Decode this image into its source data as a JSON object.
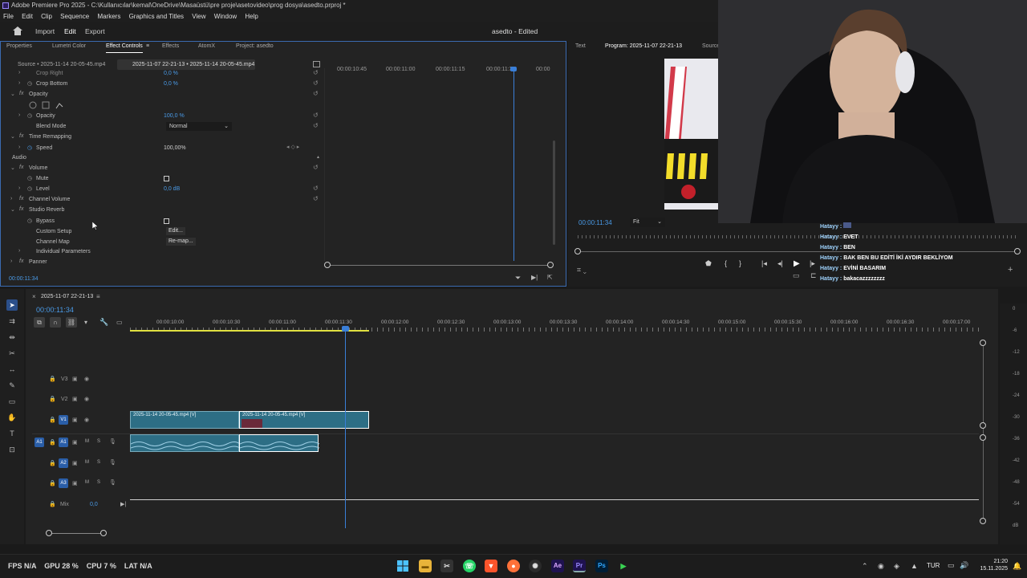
{
  "window": {
    "title": "Adobe Premiere Pro 2025 - C:\\Kullanıcılar\\kemal\\OneDrive\\Masaüstü\\pre proje\\asetovideo\\prog dosya\\asedto.prproj *"
  },
  "menu": [
    "File",
    "Edit",
    "Clip",
    "Sequence",
    "Markers",
    "Graphics and Titles",
    "View",
    "Window",
    "Help"
  ],
  "workspace": {
    "import": "Import",
    "edit": "Edit",
    "export": "Export",
    "project": "asedto - Edited"
  },
  "left_tabs": [
    "Properties",
    "Lumetri Color",
    "Effect Controls",
    "Effects",
    "AtomX",
    "Project: asedto"
  ],
  "ec": {
    "source": "Source • 2025-11-14 20-05-45.mp4",
    "sequence": "2025-11-07 22-21-13 • 2025-11-14 20-05-45.mp4",
    "ruler": [
      "00:00:10:45",
      "00:00:11:00",
      "00:00:11:15",
      "00:00:11:30",
      "00:00"
    ],
    "rows": {
      "crop_right": "Crop Right",
      "crop_right_val": "0,0 %",
      "crop_bottom": "Crop Bottom",
      "crop_bottom_val": "0,0 %",
      "opacity_hdr": "Opacity",
      "opacity": "Opacity",
      "opacity_val": "100,0 %",
      "blend": "Blend Mode",
      "blend_val": "Normal",
      "time_remap": "Time Remapping",
      "speed": "Speed",
      "speed_val": "100,00%",
      "audio": "Audio",
      "volume": "Volume",
      "mute": "Mute",
      "level": "Level",
      "level_val": "0,0 dB",
      "chan_vol": "Channel Volume",
      "reverb": "Studio Reverb",
      "bypass": "Bypass",
      "custom": "Custom Setup",
      "custom_btn": "Edit...",
      "chan_map": "Channel Map",
      "chan_map_btn": "Re-map...",
      "indiv": "Individual Parameters",
      "panner": "Panner"
    },
    "timecode": "00:00:11:34"
  },
  "program": {
    "tabs": [
      "Text",
      "Program: 2025-11-07 22-21-13",
      "Source"
    ],
    "timecode": "00:00:11:34",
    "fit": "Fit"
  },
  "timeline": {
    "seq_name": "2025-11-07 22-21-13",
    "timecode": "00:00:11:34",
    "ruler": [
      "00:00:10:00",
      "00:00:10:30",
      "00:00:11:00",
      "00:00:11:30",
      "00:00:12:00",
      "00:00:12:30",
      "00:00:13:00",
      "00:00:13:30",
      "00:00:14:00",
      "00:00:14:30",
      "00:00:15:00",
      "00:00:15:30",
      "00:00:16:00",
      "00:00:16:30",
      "00:00:17:00"
    ],
    "tracks": {
      "v3": "V3",
      "v2": "V2",
      "v1": "V1",
      "a1": "A1",
      "a2": "A2",
      "a3": "A3",
      "mix": "Mix",
      "mix_val": "0,0"
    },
    "clip1": "2025-11-14 20-05-45.mp4 [V]",
    "clip2": "2025-11-14 20-05-45.mp4 [V]",
    "meter_scale": [
      "0",
      "-6",
      "-12",
      "-18",
      "-24",
      "-30",
      "-36",
      "-42",
      "-48",
      "-54",
      "dB"
    ]
  },
  "chat": [
    {
      "name": "Hatayy :",
      "msg": ""
    },
    {
      "name": "Hatayy :",
      "msg": "EVET"
    },
    {
      "name": "Hatayy :",
      "msg": "BEN"
    },
    {
      "name": "Hatayy :",
      "msg": "BAK BEN BU EDİTİ İKİ AYDIR BEKLİYOM"
    },
    {
      "name": "Hatayy :",
      "msg": "EVİNİ BASARIM"
    },
    {
      "name": "Hatayy :",
      "msg": "bakacazzzzzzzz"
    }
  ],
  "stats": {
    "fps_l": "FPS",
    "fps": "N/A",
    "gpu_l": "GPU",
    "gpu": "28 %",
    "cpu_l": "CPU",
    "cpu": "7 %",
    "lat_l": "LAT",
    "lat": "N/A"
  },
  "tray": {
    "lang": "TUR",
    "time": "21:20",
    "date": "15.11.2025"
  }
}
